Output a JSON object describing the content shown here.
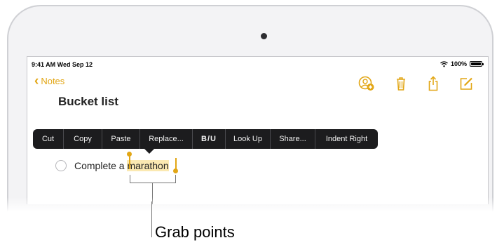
{
  "status_bar": {
    "time_date": "9:41 AM  Wed Sep 12",
    "battery": "100%"
  },
  "nav": {
    "back_label": "Notes"
  },
  "note": {
    "title": "Bucket list",
    "item_prefix": "Complete a ",
    "item_selected": "marathon"
  },
  "edit_menu": {
    "cut": "Cut",
    "copy": "Copy",
    "paste": "Paste",
    "replace": "Replace...",
    "format": "B/U",
    "look_up": "Look Up",
    "share": "Share...",
    "indent_right": "Indent Right"
  },
  "callout": {
    "label": "Grab points"
  },
  "colors": {
    "accent": "#e2a615",
    "selection": "#fbe9b2",
    "menu_bg": "#1c1c1e"
  },
  "icons": [
    "chevron-left-icon",
    "add-person-icon",
    "trash-icon",
    "share-icon",
    "compose-icon",
    "wifi-icon",
    "battery-icon"
  ]
}
